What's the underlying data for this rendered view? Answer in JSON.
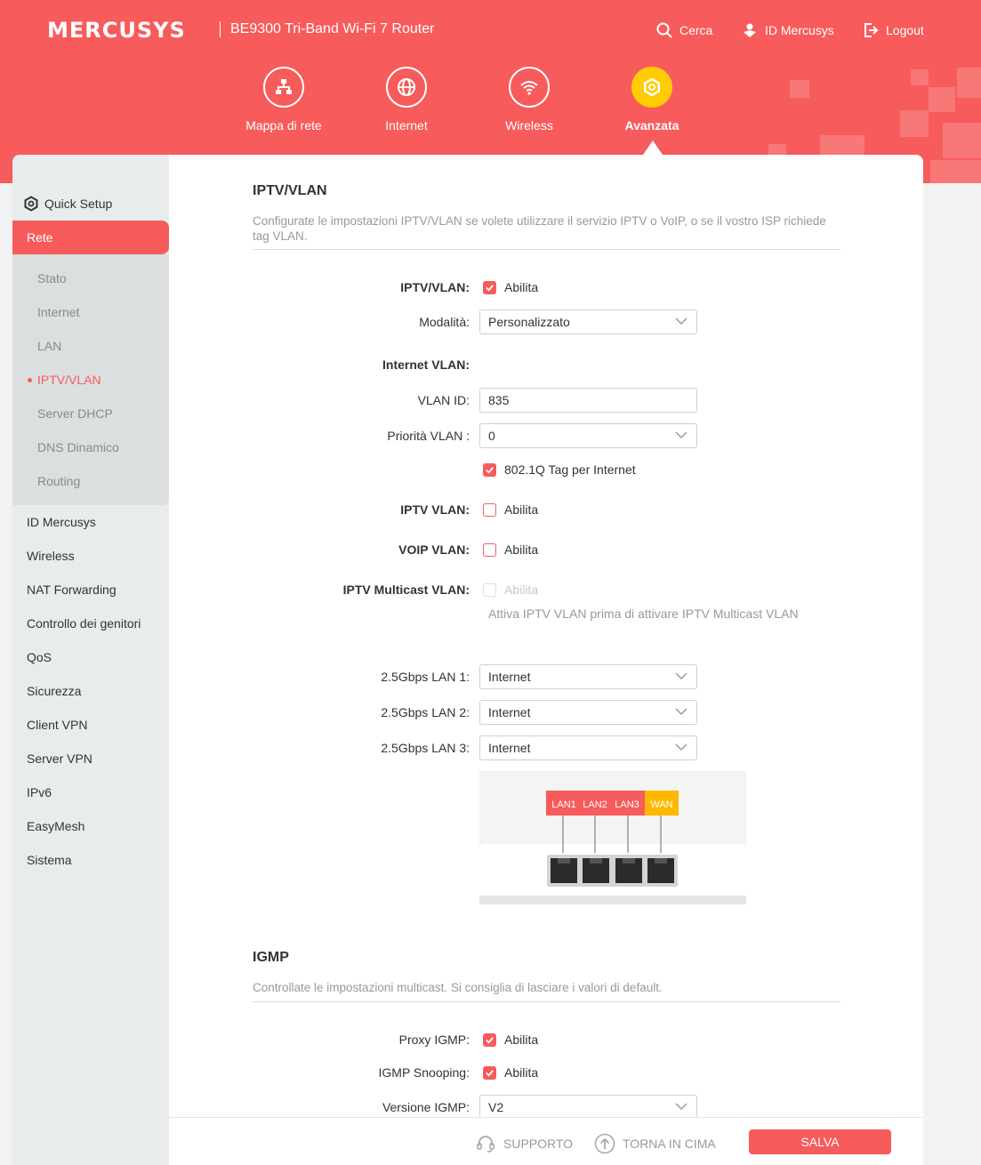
{
  "header": {
    "logo": "MERCUSYS",
    "model": "BE9300 Tri-Band Wi-Fi 7 Router",
    "links": {
      "search": "Cerca",
      "account": "ID Mercusys",
      "logout": "Logout"
    },
    "nav": [
      {
        "label": "Mappa di rete",
        "icon": "network-map-icon"
      },
      {
        "label": "Internet",
        "icon": "globe-icon"
      },
      {
        "label": "Wireless",
        "icon": "wifi-icon"
      },
      {
        "label": "Avanzata",
        "icon": "gear-icon",
        "active": true
      }
    ]
  },
  "sidebar": {
    "quick_setup": "Quick Setup",
    "active_section": "Rete",
    "sub_items": [
      "Stato",
      "Internet",
      "LAN",
      "IPTV/VLAN",
      "Server DHCP",
      "DNS Dinamico",
      "Routing"
    ],
    "active_sub": "IPTV/VLAN",
    "items": [
      "ID Mercusys",
      "Wireless",
      "NAT Forwarding",
      "Controllo dei genitori",
      "QoS",
      "Sicurezza",
      "Client VPN",
      "Server VPN",
      "IPv6",
      "EasyMesh",
      "Sistema"
    ]
  },
  "iptv": {
    "title": "IPTV/VLAN",
    "description": "Configurate le impostazioni IPTV/VLAN se volete utilizzare il servizio IPTV o VoIP, o se il vostro ISP richiede tag VLAN.",
    "enable_label": "IPTV/VLAN:",
    "enable_text": "Abilita",
    "enable_checked": true,
    "mode_label": "Modalità:",
    "mode_value": "Personalizzato",
    "internet_vlan_label": "Internet VLAN:",
    "vlan_id_label": "VLAN ID:",
    "vlan_id_value": "835",
    "priority_label": "Priorità VLAN :",
    "priority_value": "0",
    "tag_text": "802.1Q Tag per Internet",
    "tag_checked": true,
    "iptv_vlan_label": "IPTV VLAN:",
    "iptv_vlan_text": "Abilita",
    "iptv_vlan_checked": false,
    "voip_vlan_label": "VOIP VLAN:",
    "voip_vlan_text": "Abilita",
    "voip_vlan_checked": false,
    "multicast_label": "IPTV Multicast VLAN:",
    "multicast_text": "Abilita",
    "multicast_checked": false,
    "multicast_hint": "Attiva IPTV VLAN prima di attivare IPTV Multicast VLAN",
    "ports": [
      {
        "label": "2.5Gbps LAN 1:",
        "value": "Internet"
      },
      {
        "label": "2.5Gbps LAN 2:",
        "value": "Internet"
      },
      {
        "label": "2.5Gbps LAN 3:",
        "value": "Internet"
      }
    ],
    "diagram_labels": [
      "LAN1",
      "LAN2",
      "LAN3",
      "WAN"
    ],
    "diagram_colors": {
      "lan": "#f75b5b",
      "wan": "#ffb800"
    }
  },
  "igmp": {
    "title": "IGMP",
    "description": "Controllate le impostazioni multicast. Si consiglia di lasciare i valori di default.",
    "proxy_label": "Proxy IGMP:",
    "proxy_text": "Abilita",
    "proxy_checked": true,
    "snooping_label": "IGMP Snooping:",
    "snooping_text": "Abilita",
    "snooping_checked": true,
    "version_label": "Versione IGMP:",
    "version_value": "V2"
  },
  "footer": {
    "support": "SUPPORTO",
    "top": "TORNA IN CIMA",
    "save": "SALVA"
  },
  "colors": {
    "brand": "#f75b5b",
    "accent": "#ffcc00"
  }
}
